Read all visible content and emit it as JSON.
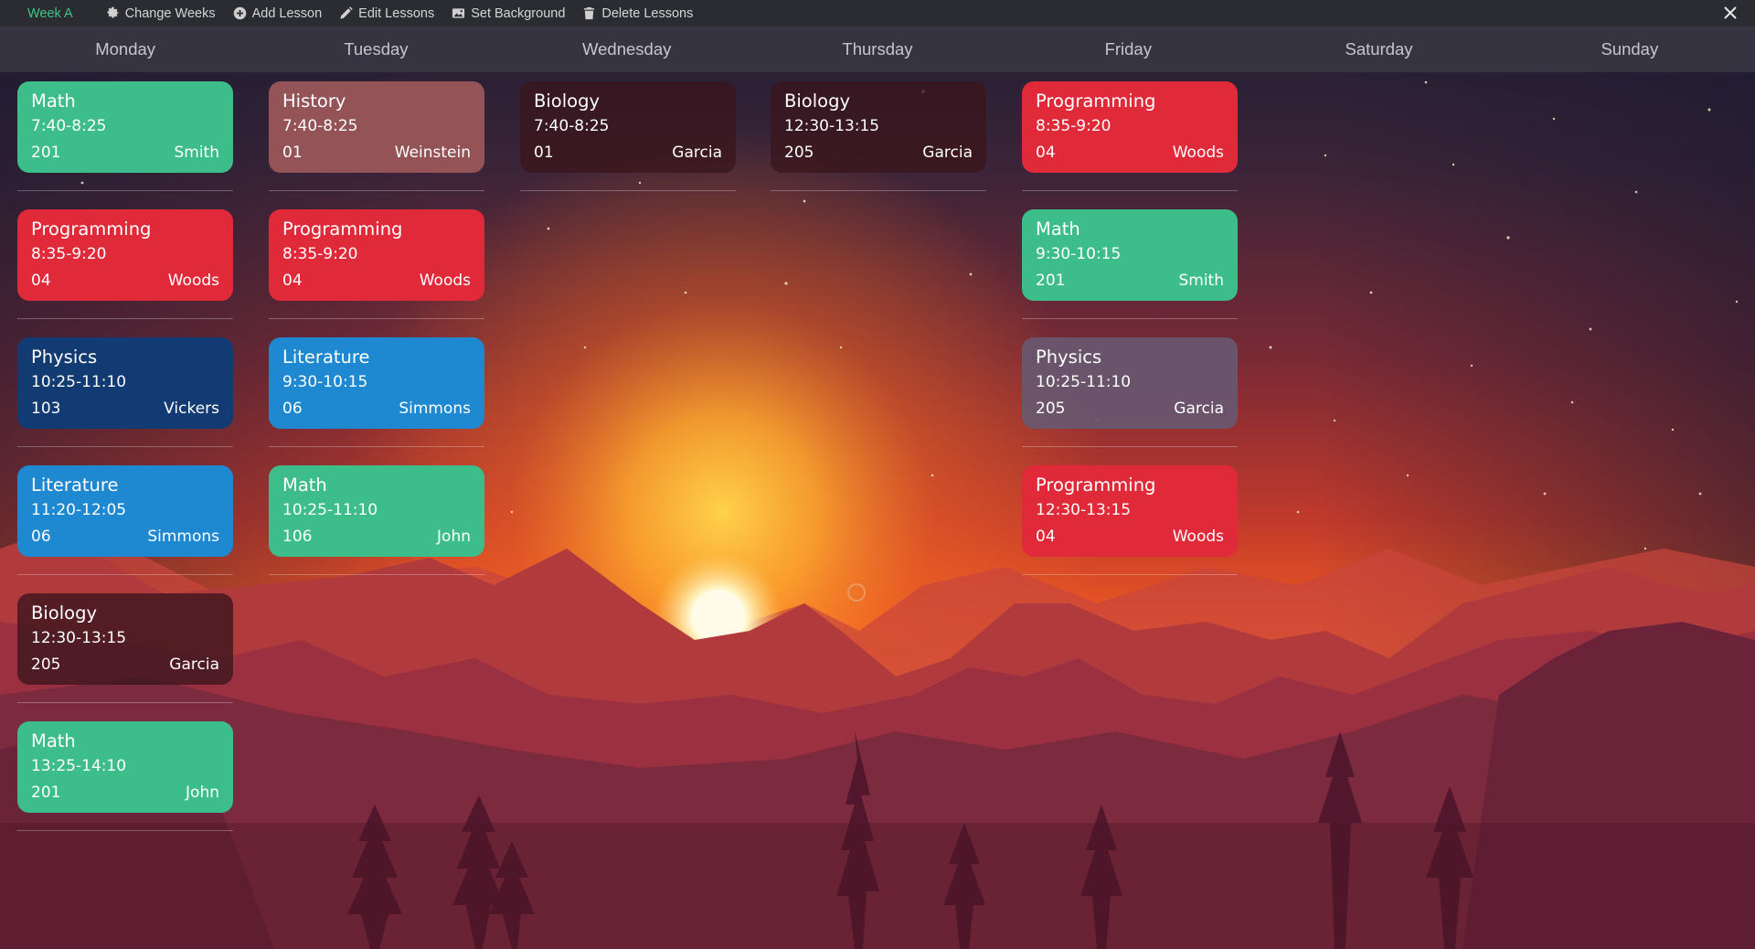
{
  "toolbar": {
    "week": "Week A",
    "buttons": [
      {
        "label": "Change Weeks",
        "icon": "gear-icon"
      },
      {
        "label": "Add Lesson",
        "icon": "plus-circle-icon"
      },
      {
        "label": "Edit Lessons",
        "icon": "pencil-icon"
      },
      {
        "label": "Set Background",
        "icon": "image-icon"
      },
      {
        "label": "Delete Lessons",
        "icon": "trash-icon"
      }
    ],
    "close_icon": "close-icon"
  },
  "days": [
    "Monday",
    "Tuesday",
    "Wednesday",
    "Thursday",
    "Friday",
    "Saturday",
    "Sunday"
  ],
  "colors": {
    "green": "#3dbd8a",
    "red": "#e02a3a",
    "blue": "#1e88d0",
    "navy": "#123a73",
    "dark": "rgba(58,22,28,0.78)",
    "mauve": "rgba(156,88,90,0.92)",
    "gray": "rgba(104,88,112,0.92)",
    "accent": "#3ec486"
  },
  "columns": [
    [
      {
        "subject": "Math",
        "time": "7:40-8:25",
        "room": "201",
        "teacher": "Smith",
        "color": "green"
      },
      {
        "subject": "Programming",
        "time": "8:35-9:20",
        "room": "04",
        "teacher": "Woods",
        "color": "red"
      },
      {
        "subject": "Physics",
        "time": "10:25-11:10",
        "room": "103",
        "teacher": "Vickers",
        "color": "navy"
      },
      {
        "subject": "Literature",
        "time": "11:20-12:05",
        "room": "06",
        "teacher": "Simmons",
        "color": "blue"
      },
      {
        "subject": "Biology",
        "time": "12:30-13:15",
        "room": "205",
        "teacher": "Garcia",
        "color": "dark"
      },
      {
        "subject": "Math",
        "time": "13:25-14:10",
        "room": "201",
        "teacher": "John",
        "color": "green"
      }
    ],
    [
      {
        "subject": "History",
        "time": "7:40-8:25",
        "room": "01",
        "teacher": "Weinstein",
        "color": "mauve"
      },
      {
        "subject": "Programming",
        "time": "8:35-9:20",
        "room": "04",
        "teacher": "Woods",
        "color": "red"
      },
      {
        "subject": "Literature",
        "time": "9:30-10:15",
        "room": "06",
        "teacher": "Simmons",
        "color": "blue"
      },
      {
        "subject": "Math",
        "time": "10:25-11:10",
        "room": "106",
        "teacher": "John",
        "color": "green"
      }
    ],
    [
      {
        "subject": "Biology",
        "time": "7:40-8:25",
        "room": "01",
        "teacher": "Garcia",
        "color": "dark"
      }
    ],
    [
      {
        "subject": "Biology",
        "time": "12:30-13:15",
        "room": "205",
        "teacher": "Garcia",
        "color": "dark"
      }
    ],
    [
      {
        "subject": "Programming",
        "time": "8:35-9:20",
        "room": "04",
        "teacher": "Woods",
        "color": "red"
      },
      {
        "subject": "Math",
        "time": "9:30-10:15",
        "room": "201",
        "teacher": "Smith",
        "color": "green"
      },
      {
        "subject": "Physics",
        "time": "10:25-11:10",
        "room": "205",
        "teacher": "Garcia",
        "color": "gray"
      },
      {
        "subject": "Programming",
        "time": "12:30-13:15",
        "room": "04",
        "teacher": "Woods",
        "color": "red"
      }
    ],
    [],
    []
  ]
}
